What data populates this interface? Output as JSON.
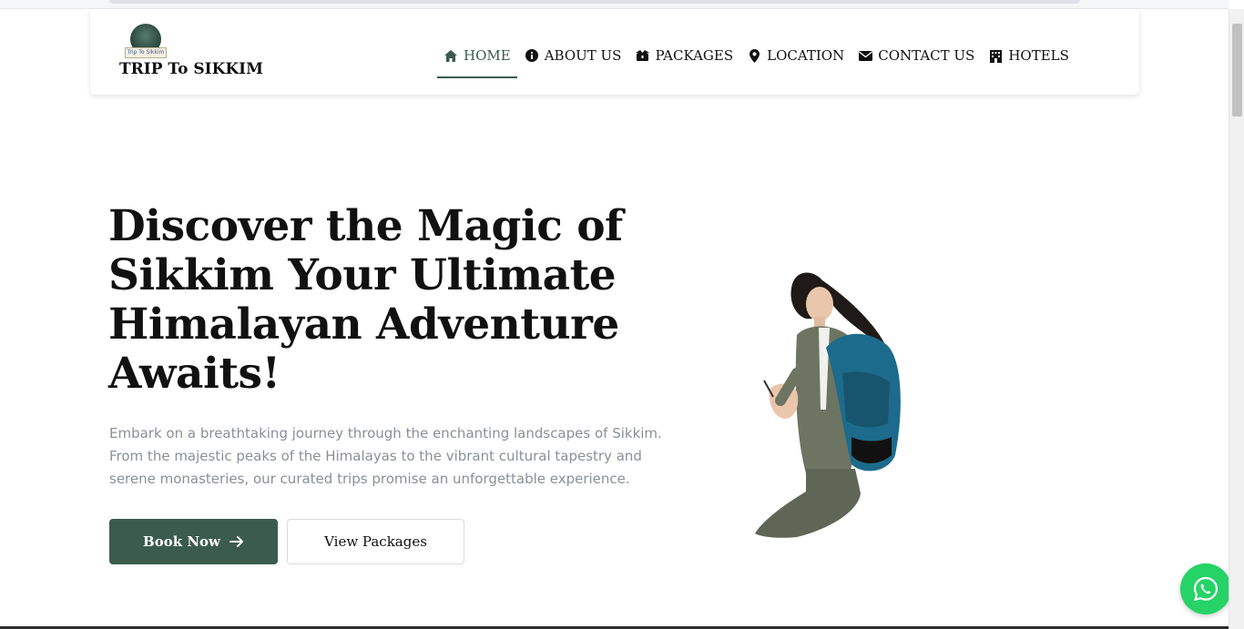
{
  "brand": {
    "logo_text": "Trip To Sikkim",
    "name": "TRIP To SIKKIM"
  },
  "nav": {
    "items": [
      {
        "label": "HOME",
        "icon": "home-icon",
        "active": true
      },
      {
        "label": "ABOUT US",
        "icon": "info-icon",
        "active": false
      },
      {
        "label": "PACKAGES",
        "icon": "box-icon",
        "active": false
      },
      {
        "label": "LOCATION",
        "icon": "map-pin-icon",
        "active": false
      },
      {
        "label": "CONTACT US",
        "icon": "envelope-icon",
        "active": false
      },
      {
        "label": "HOTELS",
        "icon": "hotel-icon",
        "active": false
      }
    ]
  },
  "hero": {
    "title": "Discover the Magic of Sikkim Your Ultimate Himalayan Adventure Awaits!",
    "description": "Embark on a breathtaking journey through the enchanting landscapes of Sikkim. From the majestic peaks of the Himalayas to the vibrant cultural tapestry and serene monasteries, our curated trips promise an unforgettable experience.",
    "primary_button": "Book Now",
    "secondary_button": "View Packages"
  },
  "colors": {
    "accent": "#3b5b4f",
    "whatsapp": "#25d366",
    "muted_text": "#8b8f98"
  }
}
